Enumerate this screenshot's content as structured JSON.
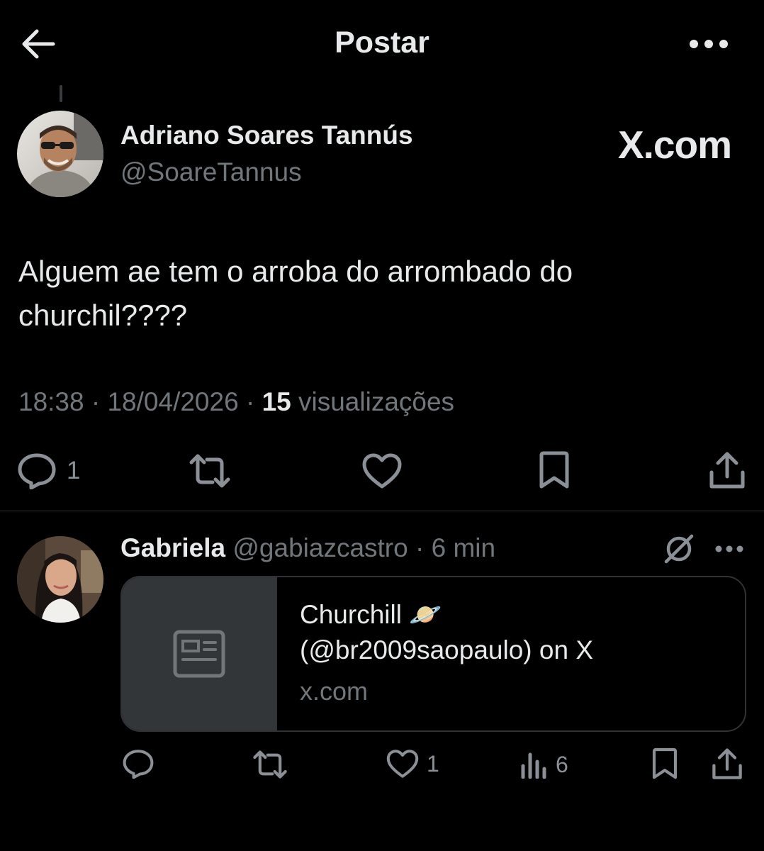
{
  "header": {
    "title": "Postar",
    "back_icon": "arrow-left-icon",
    "more_icon": "ellipsis-icon"
  },
  "post": {
    "author_name": "Adriano Soares Tannús",
    "author_handle": "@SoareTannus",
    "badge": "X.com",
    "text": "Alguem ae tem o arroba do arrombado do churchil????",
    "time": "18:38",
    "date": "18/04/2026",
    "views_count": "15",
    "views_label": "visualizações",
    "meta_sep": " · ",
    "reply_count": "1"
  },
  "reply": {
    "author_name": "Gabriela",
    "author_handle": "@gabiazcastro",
    "time_sep": " · ",
    "time": "6 min",
    "card": {
      "title_line1": "Churchill 🪐",
      "title_line2": "(@br2009saopaulo) on X",
      "domain": "x.com",
      "thumb_icon": "article-icon"
    },
    "like_count": "1",
    "views_count": "6"
  },
  "colors": {
    "background": "#000000",
    "text_primary": "#e7e9ea",
    "text_secondary": "#71767b",
    "divider": "#2f3336",
    "card_thumb": "#333639"
  }
}
